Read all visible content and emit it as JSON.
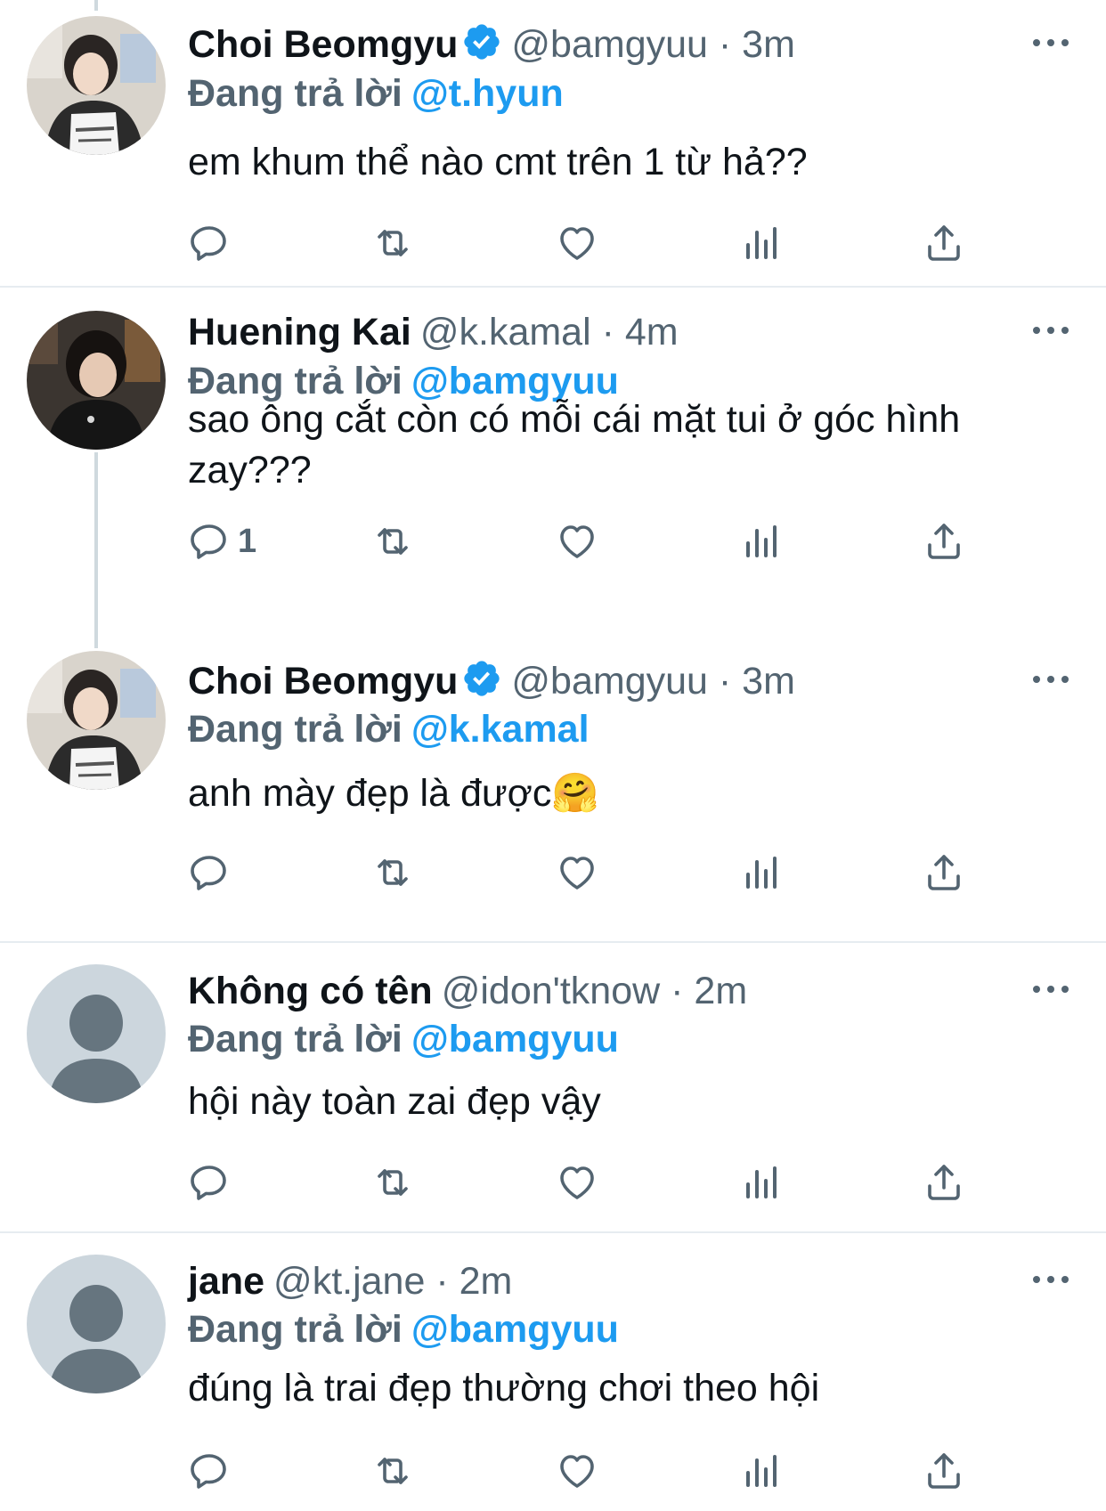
{
  "colors": {
    "accent": "#1d9bf0",
    "secondary_text": "#536471",
    "primary_text": "#0f1419",
    "divider": "#e6ecf0"
  },
  "tweets": [
    {
      "name": "Choi Beomgyu",
      "verified": true,
      "handle": "@bamgyuu",
      "time": "· 3m",
      "reply_prefix": "Đang trả lời",
      "reply_to": "@t.hyun",
      "text": "em khum thể nào cmt trên 1 từ hả??",
      "reply_count": "",
      "avatar_icon": "profile-photo"
    },
    {
      "name": "Huening Kai",
      "verified": false,
      "handle": "@k.kamal",
      "time": "· 4m",
      "reply_prefix": "Đang trả lời",
      "reply_to": "@bamgyuu",
      "text": "sao ông cắt còn có mỗi cái mặt tui ở góc hình zay???",
      "reply_count": "1",
      "avatar_icon": "profile-photo"
    },
    {
      "name": "Choi Beomgyu",
      "verified": true,
      "handle": "@bamgyuu",
      "time": "· 3m",
      "reply_prefix": "Đang trả lời",
      "reply_to": "@k.kamal",
      "text": "anh mày đẹp là được🤗",
      "reply_count": "",
      "avatar_icon": "profile-photo"
    },
    {
      "name": "Không có tên",
      "verified": false,
      "handle": "@idon'tknow",
      "time": "· 2m",
      "reply_prefix": "Đang trả lời",
      "reply_to": "@bamgyuu",
      "text": "hội này toàn zai đẹp vậy",
      "reply_count": "",
      "avatar_icon": "default-avatar-icon"
    },
    {
      "name": "jane",
      "verified": false,
      "handle": "@kt.jane",
      "time": "· 2m",
      "reply_prefix": "Đang trả lời",
      "reply_to": "@bamgyuu",
      "text": "đúng là trai đẹp thường chơi theo hội",
      "reply_count": "",
      "avatar_icon": "default-avatar-icon"
    }
  ],
  "action_icons": [
    "reply-icon",
    "retweet-icon",
    "like-icon",
    "analytics-icon",
    "share-icon"
  ]
}
